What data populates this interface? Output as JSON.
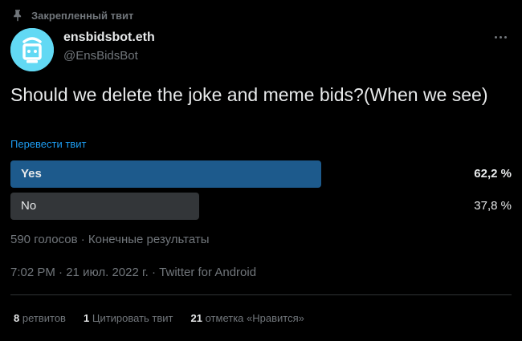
{
  "pinned": {
    "label": "Закрепленный твит",
    "icon": "pin-icon"
  },
  "author": {
    "name": "ensbidsbot.eth",
    "handle": "@EnsBidsBot",
    "avatar_color": "#62d9f4"
  },
  "more_icon": "more-icon",
  "tweet": {
    "text": "Should we delete the joke and meme bids?(When we see)",
    "translate_label": "Перевести твит"
  },
  "poll": {
    "options": [
      {
        "label": "Yes",
        "percent_text": "62,2 %",
        "share": 0.622,
        "bar_color": "#1d5a8c"
      },
      {
        "label": "No",
        "percent_text": "37,8 %",
        "share": 0.378,
        "bar_color": "#333639"
      }
    ],
    "meta": "590 голосов · Конечные результаты"
  },
  "meta": {
    "time": "7:02 PM",
    "date": "21 июл. 2022 г.",
    "source": "Twitter for Android"
  },
  "stats": {
    "retweets": {
      "count": "8",
      "label": "ретвитов"
    },
    "quotes": {
      "count": "1",
      "label": "Цитировать твит"
    },
    "likes": {
      "count": "21",
      "label": "отметка «Нравится»"
    }
  },
  "colors": {
    "background": "#000000",
    "text": "#e7e9ea",
    "secondary": "#71767b",
    "link": "#1d9bf0"
  }
}
